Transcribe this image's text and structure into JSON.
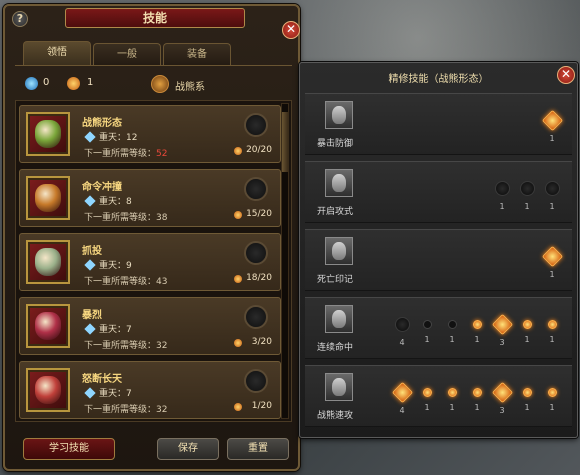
{
  "left_panel": {
    "title": "技能",
    "help_label": "?",
    "close_label": "✕",
    "tabs": [
      {
        "label": "领悟"
      },
      {
        "label": "一般"
      },
      {
        "label": "装备"
      }
    ],
    "resources": {
      "blue_points": "0",
      "orange_points": "1",
      "school": "战熊系"
    },
    "skills": [
      {
        "name": "战熊形态",
        "tier_label": "重天：12",
        "req_label": "下一重所需等级：",
        "req_level": "52",
        "req_level_red": true,
        "points": "20/20",
        "face_color": "#7aa63a"
      },
      {
        "name": "命令冲撞",
        "tier_label": "重天：8",
        "req_label": "下一重所需等级：",
        "req_level": "38",
        "req_level_red": false,
        "points": "15/20",
        "face_color": "#c77a2a"
      },
      {
        "name": "抓投",
        "tier_label": "重天：9",
        "req_label": "下一重所需等级：",
        "req_level": "43",
        "req_level_red": false,
        "points": "18/20",
        "face_color": "#9ab08a"
      },
      {
        "name": "暴烈",
        "tier_label": "重天：7",
        "req_label": "下一重所需等级：",
        "req_level": "32",
        "req_level_red": false,
        "points": "3/20",
        "face_color": "#b03048"
      },
      {
        "name": "怒断长天",
        "tier_label": "重天：7",
        "req_label": "下一重所需等级：",
        "req_level": "32",
        "req_level_red": false,
        "points": "1/20",
        "face_color": "#c0403a"
      }
    ],
    "buttons": {
      "learn": "学习技能",
      "save": "保存",
      "reset": "重置"
    }
  },
  "right_panel": {
    "title": "精修技能（战熊形态）",
    "close_label": "✕",
    "rows": [
      {
        "name": "暴击防御",
        "nodes": [
          {
            "level": "1",
            "lit": true,
            "kind": "star"
          }
        ]
      },
      {
        "name": "开启攻式",
        "nodes": [
          {
            "level": "1",
            "lit": false,
            "kind": "big"
          },
          {
            "level": "1",
            "lit": false,
            "kind": "big"
          },
          {
            "level": "1",
            "lit": false,
            "kind": "big"
          }
        ]
      },
      {
        "name": "死亡印记",
        "nodes": [
          {
            "level": "1",
            "lit": true,
            "kind": "star"
          }
        ]
      },
      {
        "name": "连续命中",
        "nodes": [
          {
            "level": "4",
            "lit": false,
            "kind": "big"
          },
          {
            "level": "1",
            "lit": false,
            "kind": "small"
          },
          {
            "level": "1",
            "lit": false,
            "kind": "small"
          },
          {
            "level": "1",
            "lit": true,
            "kind": "small"
          },
          {
            "level": "3",
            "lit": true,
            "kind": "star"
          },
          {
            "level": "1",
            "lit": true,
            "kind": "small"
          },
          {
            "level": "1",
            "lit": true,
            "kind": "small"
          }
        ]
      },
      {
        "name": "战熊速攻",
        "nodes": [
          {
            "level": "4",
            "lit": true,
            "kind": "star"
          },
          {
            "level": "1",
            "lit": true,
            "kind": "small"
          },
          {
            "level": "1",
            "lit": true,
            "kind": "small"
          },
          {
            "level": "1",
            "lit": true,
            "kind": "small"
          },
          {
            "level": "3",
            "lit": true,
            "kind": "star"
          },
          {
            "level": "1",
            "lit": true,
            "kind": "small"
          },
          {
            "level": "1",
            "lit": true,
            "kind": "small"
          }
        ]
      }
    ]
  }
}
